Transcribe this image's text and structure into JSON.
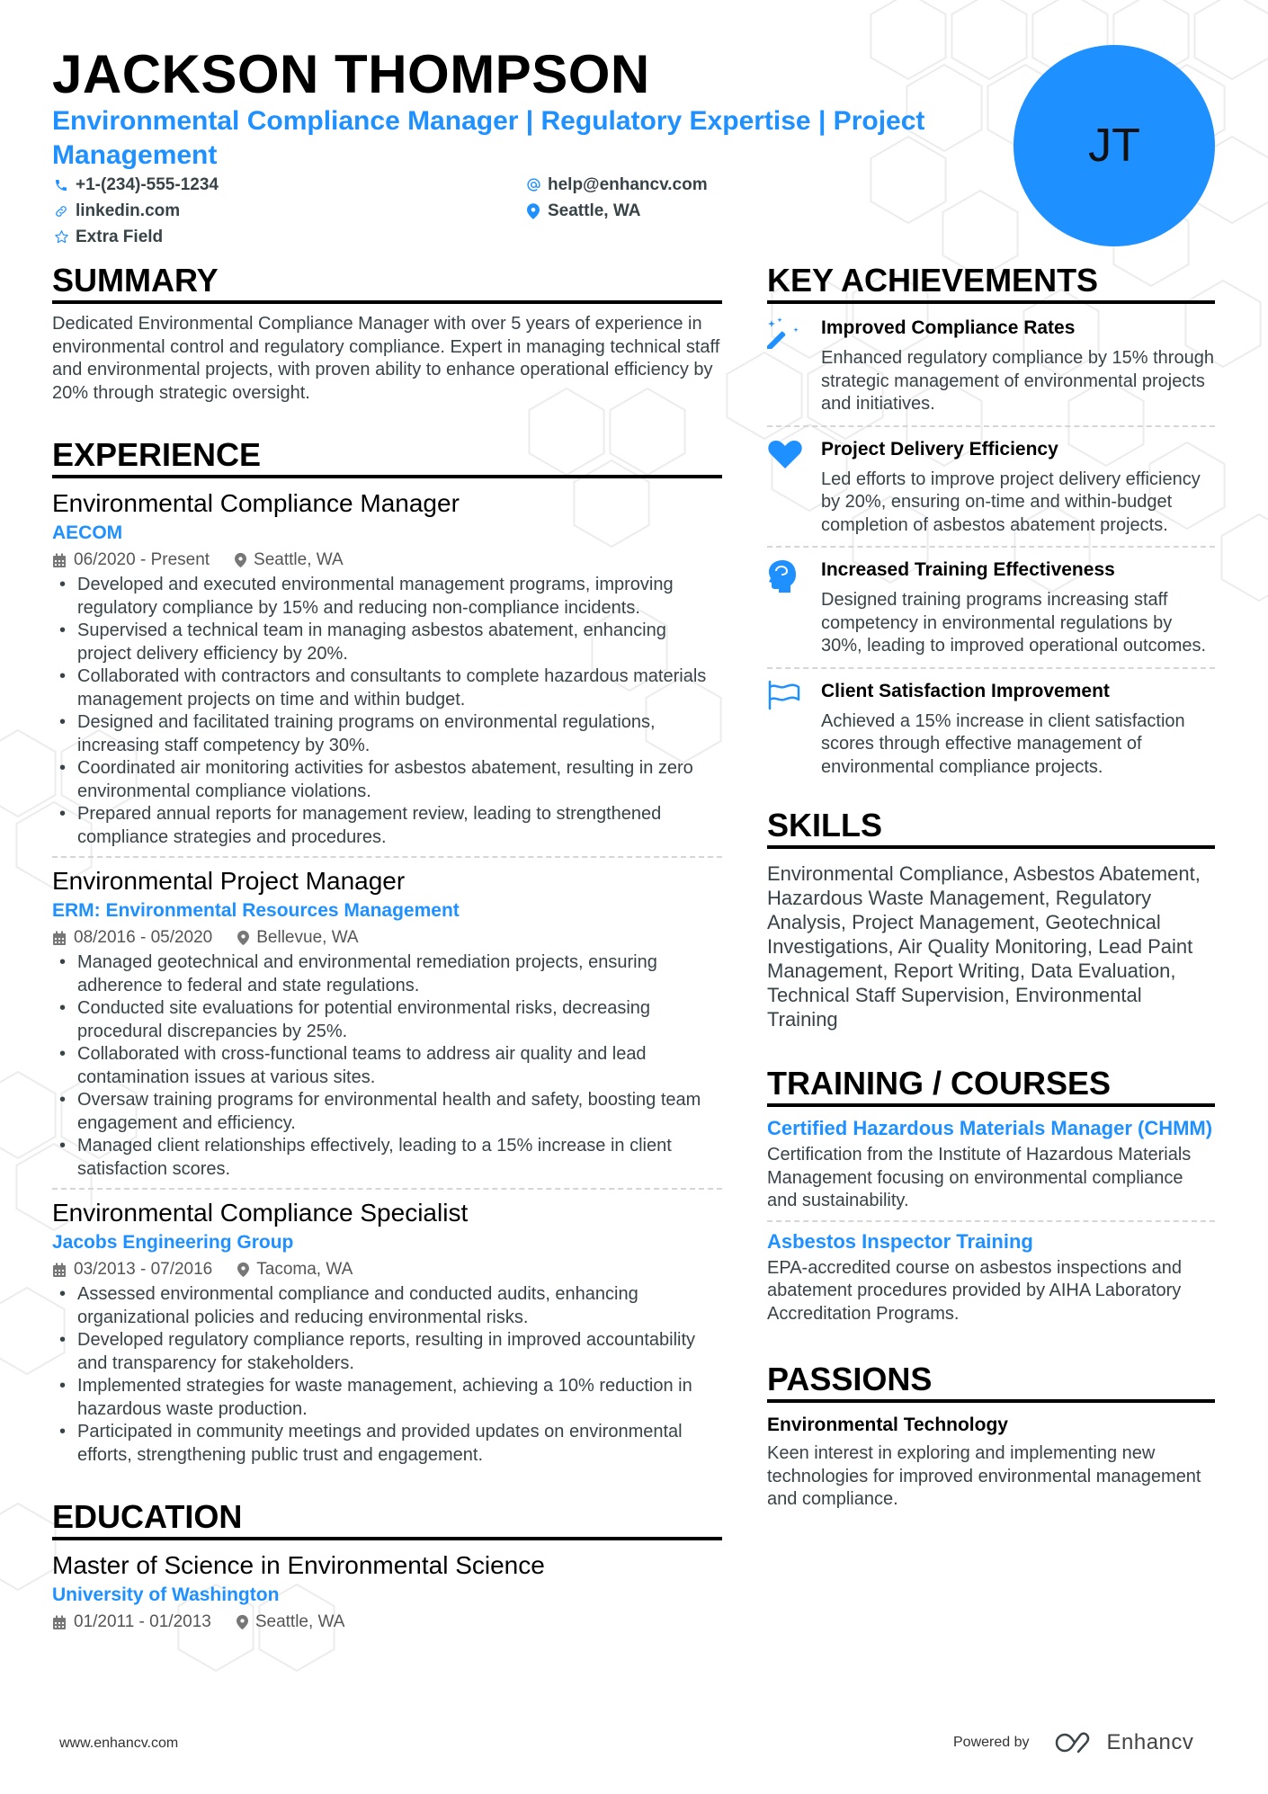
{
  "header": {
    "name": "JACKSON THOMPSON",
    "headline": "Environmental Compliance Manager | Regulatory Expertise | Project Management",
    "avatar_initials": "JT",
    "contacts": [
      {
        "icon": "phone-icon",
        "text": "+1-(234)-555-1234"
      },
      {
        "icon": "at-icon",
        "text": "help@enhancv.com"
      },
      {
        "icon": "link-icon",
        "text": "linkedin.com"
      },
      {
        "icon": "location-pin-icon",
        "text": "Seattle, WA"
      },
      {
        "icon": "star-icon",
        "text": "Extra Field"
      }
    ]
  },
  "colors": {
    "accent": "#1e90ff",
    "text": "#384347",
    "heading": "#000000"
  },
  "summary": {
    "title": "SUMMARY",
    "text": "Dedicated Environmental Compliance Manager with over 5 years of experience in environmental control and regulatory compliance. Expert in managing technical staff and environmental projects, with proven ability to enhance operational efficiency by 20% through strategic oversight."
  },
  "experience": {
    "title": "EXPERIENCE",
    "jobs": [
      {
        "title": "Environmental Compliance Manager",
        "company": "AECOM",
        "dates": "06/2020 - Present",
        "location": "Seattle, WA",
        "bullets": [
          "Developed and executed environmental management programs, improving regulatory compliance by 15% and reducing non-compliance incidents.",
          "Supervised a technical team in managing asbestos abatement, enhancing project delivery efficiency by 20%.",
          "Collaborated with contractors and consultants to complete hazardous materials management projects on time and within budget.",
          "Designed and facilitated training programs on environmental regulations, increasing staff competency by 30%.",
          "Coordinated air monitoring activities for asbestos abatement, resulting in zero environmental compliance violations.",
          "Prepared annual reports for management review, leading to strengthened compliance strategies and procedures."
        ]
      },
      {
        "title": "Environmental Project Manager",
        "company": "ERM: Environmental Resources Management",
        "dates": "08/2016 - 05/2020",
        "location": "Bellevue, WA",
        "bullets": [
          "Managed geotechnical and environmental remediation projects, ensuring adherence to federal and state regulations.",
          "Conducted site evaluations for potential environmental risks, decreasing procedural discrepancies by 25%.",
          "Collaborated with cross-functional teams to address air quality and lead contamination issues at various sites.",
          "Oversaw training programs for environmental health and safety, boosting team engagement and efficiency.",
          "Managed client relationships effectively, leading to a 15% increase in client satisfaction scores."
        ]
      },
      {
        "title": "Environmental Compliance Specialist",
        "company": "Jacobs Engineering Group",
        "dates": "03/2013 - 07/2016",
        "location": "Tacoma, WA",
        "bullets": [
          "Assessed environmental compliance and conducted audits, enhancing organizational policies and reducing environmental risks.",
          "Developed regulatory compliance reports, resulting in improved accountability and transparency for stakeholders.",
          "Implemented strategies for waste management, achieving a 10% reduction in hazardous waste production.",
          "Participated in community meetings and provided updates on environmental efforts, strengthening public trust and engagement."
        ]
      }
    ]
  },
  "education": {
    "title": "EDUCATION",
    "items": [
      {
        "degree": "Master of Science in Environmental Science",
        "school": "University of Washington",
        "dates": "01/2011 - 01/2013",
        "location": "Seattle, WA"
      }
    ]
  },
  "achievements": {
    "title": "KEY ACHIEVEMENTS",
    "items": [
      {
        "icon": "magic-wand-icon",
        "title": "Improved Compliance Rates",
        "desc": "Enhanced regulatory compliance by 15% through strategic management of environmental projects and initiatives."
      },
      {
        "icon": "heart-icon",
        "title": "Project Delivery Efficiency",
        "desc": "Led efforts to improve project delivery efficiency by 20%, ensuring on-time and within-budget completion of asbestos abatement projects."
      },
      {
        "icon": "brain-head-icon",
        "title": "Increased Training Effectiveness",
        "desc": "Designed training programs increasing staff competency in environmental regulations by 30%, leading to improved operational outcomes."
      },
      {
        "icon": "flag-icon",
        "title": "Client Satisfaction Improvement",
        "desc": "Achieved a 15% increase in client satisfaction scores through effective management of environmental compliance projects."
      }
    ]
  },
  "skills": {
    "title": "SKILLS",
    "text": "Environmental Compliance, Asbestos Abatement, Hazardous Waste Management, Regulatory Analysis, Project Management, Geotechnical Investigations, Air Quality Monitoring, Lead Paint Management, Report Writing, Data Evaluation, Technical Staff Supervision, Environmental Training"
  },
  "training": {
    "title": "TRAINING / COURSES",
    "items": [
      {
        "title": "Certified Hazardous Materials Manager (CHMM)",
        "desc": "Certification from the Institute of Hazardous Materials Management focusing on environmental compliance and sustainability."
      },
      {
        "title": "Asbestos Inspector Training",
        "desc": "EPA-accredited course on asbestos inspections and abatement procedures provided by AIHA Laboratory Accreditation Programs."
      }
    ]
  },
  "passions": {
    "title": "PASSIONS",
    "items": [
      {
        "title": "Environmental Technology",
        "desc": "Keen interest in exploring and implementing new technologies for improved environmental management and compliance."
      }
    ]
  },
  "footer": {
    "website": "www.enhancv.com",
    "powered_by": "Powered by",
    "brand": "Enhancv"
  }
}
